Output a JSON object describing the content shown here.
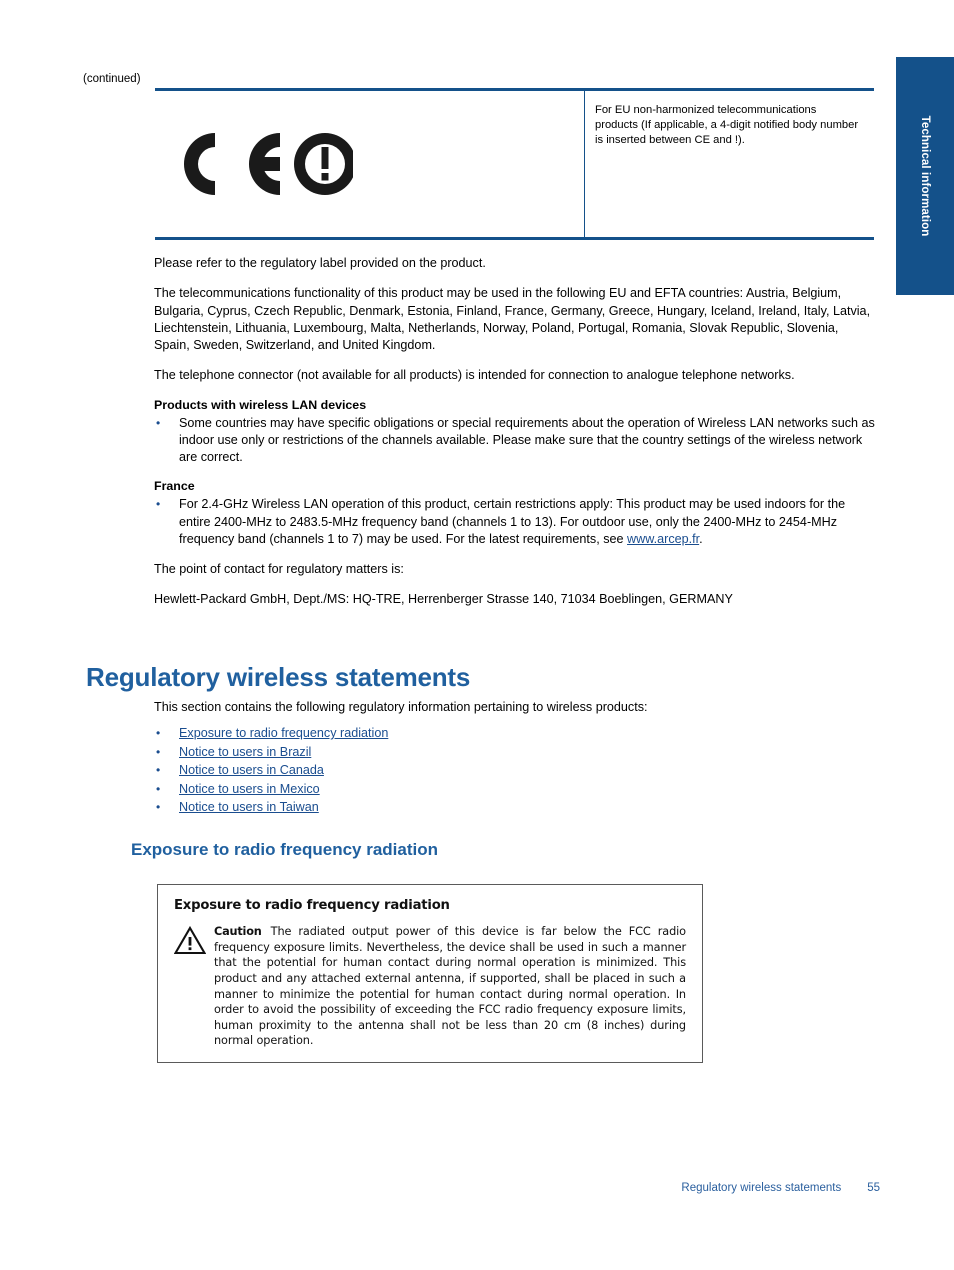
{
  "side_tab": {
    "label": "Technical information"
  },
  "continued_label": "(continued)",
  "ce_table": {
    "mark_name": "ce-mark-with-alert",
    "note": "For EU non-harmonized telecommunications products (If applicable, a 4-digit notified body number is inserted between CE and !)."
  },
  "body": {
    "para_label": "Please refer to the regulatory label provided on the product.",
    "para_countries": "The telecommunications functionality of this product may be used in the following EU and EFTA countries: Austria, Belgium, Bulgaria, Cyprus, Czech Republic, Denmark, Estonia, Finland, France, Germany, Greece, Hungary, Iceland, Ireland, Italy, Latvia, Liechtenstein, Lithuania, Luxembourg, Malta, Netherlands, Norway, Poland, Portugal, Romania, Slovak Republic, Slovenia, Spain, Sweden, Switzerland, and United Kingdom.",
    "para_telephone": "The telephone connector (not available for all products) is intended for connection to analogue telephone networks.",
    "wlan_heading": "Products with wireless LAN devices",
    "wlan_bullet": "Some countries may have specific obligations or special requirements about the operation of Wireless LAN networks such as indoor use only or restrictions of the channels available. Please make sure that the country settings of the wireless network are correct.",
    "france_heading": "France",
    "france_bullet_pre": "For 2.4-GHz Wireless LAN operation of this product, certain restrictions apply: This product may be used indoors for the entire 2400-MHz to 2483.5-MHz frequency band (channels 1 to 13). For outdoor use, only the 2400-MHz to 2454-MHz frequency band (channels 1 to 7) may be used. For the latest requirements, see ",
    "france_link": "www.arcep.fr",
    "france_bullet_post": ".",
    "para_contact": "The point of contact for regulatory matters is:",
    "para_address": "Hewlett-Packard GmbH, Dept./MS: HQ-TRE, Herrenberger Strasse 140, 71034 Boeblingen, GERMANY"
  },
  "section": {
    "title": "Regulatory wireless statements",
    "intro": "This section contains the following regulatory information pertaining to wireless products:",
    "links": [
      "Exposure to radio frequency radiation",
      "Notice to users in Brazil",
      "Notice to users in Canada",
      "Notice to users in Mexico",
      "Notice to users in Taiwan"
    ],
    "subtitle": "Exposure to radio frequency radiation"
  },
  "caution_box": {
    "title": "Exposure to radio frequency radiation",
    "lead": "Caution",
    "text": "The radiated output power of this device is far below the FCC radio frequency exposure limits. Nevertheless, the device shall be used in such a manner that the potential for human contact during normal operation is minimized. This product and any attached external antenna, if supported, shall be placed in such a manner to minimize the potential for human contact during normal operation. In order to avoid the possibility of exceeding the FCC radio frequency exposure limits, human proximity to the antenna shall not be less than 20 cm (8 inches) during normal operation."
  },
  "footer": {
    "section_name": "Regulatory wireless statements",
    "page_number": "55"
  },
  "colors": {
    "rule_blue": "#14518a",
    "heading_blue": "#20609f",
    "link_blue": "#1a4d8f",
    "footer_blue": "#2a5f9e",
    "tab_blue": "#14518a"
  },
  "bullet_glyph": "•"
}
